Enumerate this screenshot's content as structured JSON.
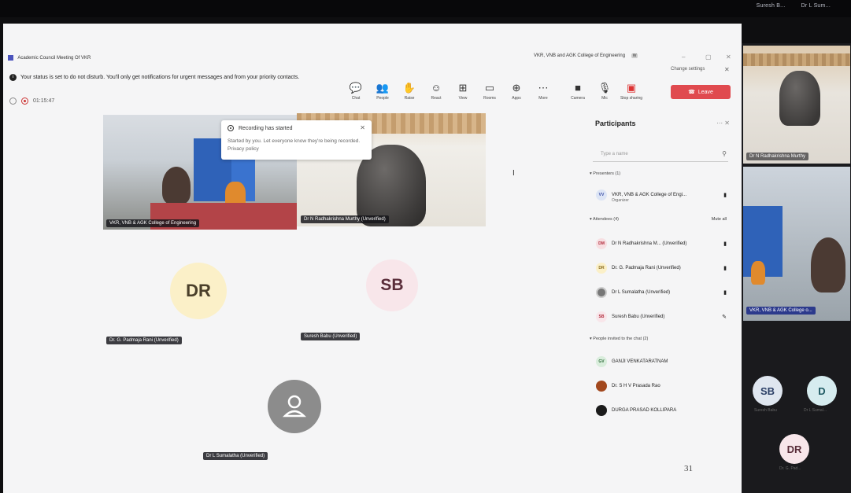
{
  "topbar": {
    "names": [
      "Suresh B...",
      "Dr L Sum..."
    ]
  },
  "window": {
    "title": "Academic Council Meeting Of VKR",
    "center_title": "VKR, VNB and AGK College of Engineering",
    "center_badge": "W",
    "min": "–",
    "max": "▢",
    "close": "✕"
  },
  "banner": {
    "text": "Your status is set to do not disturb. You'll only get notifications for urgent messages and from your priority contacts.",
    "change_settings": "Change settings",
    "close": "✕"
  },
  "call": {
    "timer": "01:15:47"
  },
  "toolbar": {
    "items": [
      {
        "label": "Chat",
        "icon": "💬"
      },
      {
        "label": "People",
        "icon": "👥"
      },
      {
        "label": "Raise",
        "icon": "✋"
      },
      {
        "label": "React",
        "icon": "☺"
      },
      {
        "label": "View",
        "icon": "⊞"
      },
      {
        "label": "Rooms",
        "icon": "▭"
      },
      {
        "label": "Apps",
        "icon": "⊕"
      },
      {
        "label": "More",
        "icon": "⋯"
      },
      {
        "label": "Camera",
        "icon": "■"
      },
      {
        "label": "Mic",
        "icon": "🎙"
      },
      {
        "label": "Stop sharing",
        "icon": "▣"
      }
    ],
    "leave_label": "Leave"
  },
  "videos": [
    {
      "name": "VKR, VNB & AGK College of Engineering"
    },
    {
      "name": "Dr N Radhakrishna Murthy (Unverified)"
    }
  ],
  "toast": {
    "title": "Recording has started",
    "body": "Started by you. Let everyone know they're being recorded. Privacy policy",
    "close": "✕"
  },
  "tiles": [
    {
      "initials": "DR",
      "name": "Dr. G. Padmaja Rani (Unverified)"
    },
    {
      "initials": "SB",
      "name": "Suresh Babu (Unverified)"
    },
    {
      "initials": "",
      "name": "Dr L Sumalatha (Unverified)"
    }
  ],
  "participants": {
    "title": "Participants",
    "search_placeholder": "Type a name",
    "presenters_label": "Presenters (1)",
    "attendees_label": "Attendees (4)",
    "mute_all": "Mute all",
    "chat_label": "People invited to the chat (2)",
    "presenters": [
      {
        "initials": "VV",
        "name": "VKR, VNB & AGK College of Engi...",
        "sub": "Organizer"
      }
    ],
    "attendees": [
      {
        "initials": "DM",
        "name": "Dr N Radhakrishna M... (Unverified)"
      },
      {
        "initials": "DR",
        "name": "Dr. G. Padmaja Rani (Unverified)"
      },
      {
        "initials": "",
        "name": "Dr L Sumalatha (Unverified)"
      },
      {
        "initials": "SB",
        "name": "Suresh Babu (Unverified)"
      }
    ],
    "invited": [
      {
        "initials": "GV",
        "name": "GANJI VENKATARATNAM"
      },
      {
        "initials": "",
        "name": "Dr. S H V Prasada Rao"
      },
      {
        "initials": "",
        "name": "DURGA PRASAD KOLLIPARA"
      }
    ]
  },
  "right_strip": {
    "tile1_name": "Dr N Radhakrishna Murthy",
    "tile2_name": "VKR, VNB & AGK College o...",
    "avatars": [
      {
        "initials": "SB",
        "label": "Suresh Babu"
      },
      {
        "initials": "D",
        "label": "Dr L Sumal..."
      },
      {
        "initials": "DR",
        "label": "Dr. G. Pad..."
      }
    ]
  },
  "page_number": "31",
  "colors": {
    "leave": "#e04a4f",
    "dr_tile": "#fbf0c8",
    "sb_tile": "#f8e6ea"
  }
}
